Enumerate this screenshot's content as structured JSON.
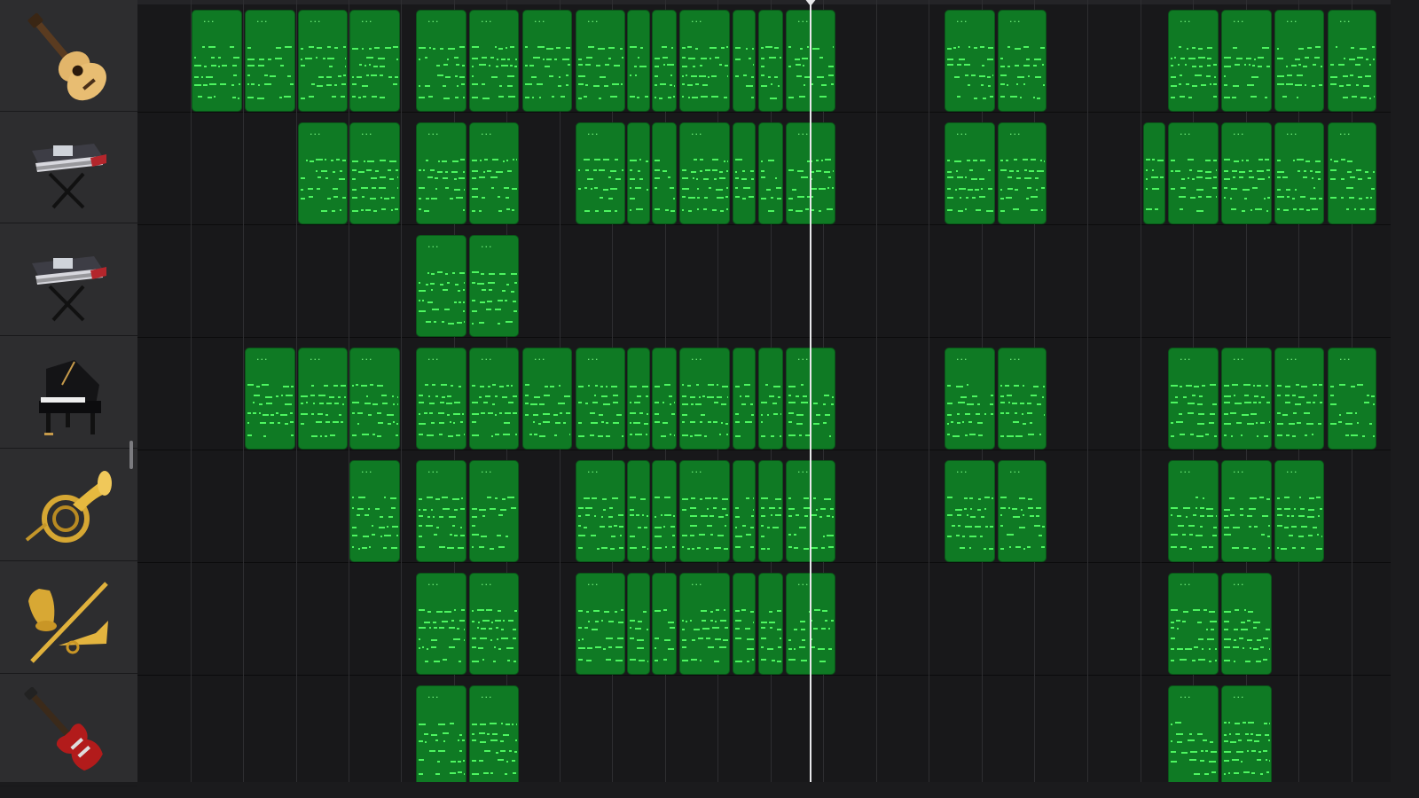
{
  "colors": {
    "region_fill": "#0f7a24",
    "region_border": "#0a5619",
    "note": "#4df560",
    "header_bg": "#2d2d2f",
    "grid_bg": "#18181a",
    "playhead": "#e8e8ea"
  },
  "region_label": "...",
  "tracks": [
    {
      "instrument": "acoustic-guitar",
      "icon": "acoustic-guitar-icon"
    },
    {
      "instrument": "synth-keyboard",
      "icon": "synth-keyboard-icon"
    },
    {
      "instrument": "synth-keyboard",
      "icon": "synth-keyboard-icon"
    },
    {
      "instrument": "grand-piano",
      "icon": "grand-piano-icon"
    },
    {
      "instrument": "french-horn",
      "icon": "french-horn-icon"
    },
    {
      "instrument": "brass",
      "icon": "brass-icon"
    },
    {
      "instrument": "electric-guitar",
      "icon": "electric-guitar-icon"
    }
  ]
}
